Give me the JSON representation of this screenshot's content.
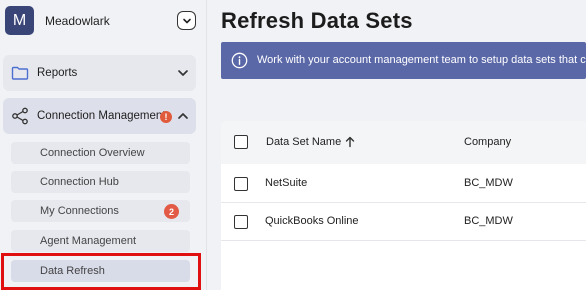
{
  "org": {
    "avatar_letter": "M",
    "name": "Meadowlark"
  },
  "sidebar": {
    "items": [
      {
        "label": "Reports",
        "icon": "folder-icon",
        "expanded": false
      },
      {
        "label": "Connection Management",
        "icon": "share-icon",
        "expanded": true,
        "alert": "!"
      }
    ],
    "sub_items": [
      {
        "label": "Connection Overview"
      },
      {
        "label": "Connection Hub"
      },
      {
        "label": "My Connections",
        "badge": "2"
      },
      {
        "label": "Agent Management"
      },
      {
        "label": "Data Refresh",
        "selected": true
      }
    ]
  },
  "main": {
    "title": "Refresh Data Sets",
    "banner_text": "Work with your account management team to setup data sets that can",
    "table": {
      "columns": [
        "Data Set Name",
        "Company"
      ],
      "sort": "ascending",
      "rows": [
        {
          "name": "NetSuite",
          "company": "BC_MDW"
        },
        {
          "name": "QuickBooks Online",
          "company": "BC_MDW"
        }
      ]
    }
  },
  "colors": {
    "avatar": "#3a4577",
    "banner": "#5b68a8",
    "alert": "#e05a3c",
    "highlight": "#e01010"
  }
}
